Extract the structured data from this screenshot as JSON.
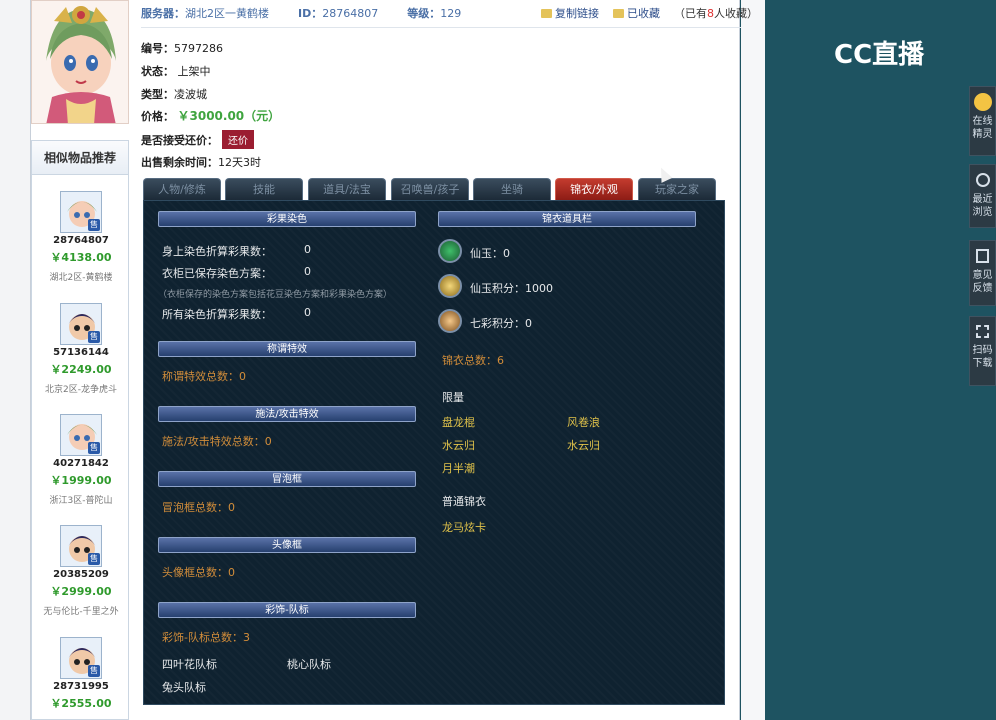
{
  "header": {
    "server_label": "服务器：",
    "server_value": "湖北2区一黄鹤楼",
    "id_label": "ID：",
    "id_value": "28764807",
    "level_label": "等级：",
    "level_value": "129",
    "copy_link": "复制链接",
    "favorited": "已收藏",
    "fav_count_prefix": "（已有",
    "fav_count": "8",
    "fav_count_suffix": "人收藏）"
  },
  "info": {
    "number_label": "编号：",
    "number_value": "5797286",
    "status_label": "状态：",
    "status_value": "上架中",
    "type_label": "类型：",
    "type_value": "凌波城",
    "price_label": "价格：",
    "price_value": "￥3000.00（元）",
    "counter_label": "是否接受还价：",
    "counter_button": "还价",
    "remaining_label": "出售剩余时间：",
    "remaining_value": "12天3时"
  },
  "similar": {
    "title": "相似物品推荐",
    "sale_tag": "售",
    "items": [
      {
        "id": "28764807",
        "price": "￥4138.00",
        "server": "湖北2区-黄鹤楼"
      },
      {
        "id": "57136144",
        "price": "￥2249.00",
        "server": "北京2区-龙争虎斗"
      },
      {
        "id": "40271842",
        "price": "￥1999.00",
        "server": "浙江3区-普陀山"
      },
      {
        "id": "20385209",
        "price": "￥2999.00",
        "server": "无与伦比-千里之外"
      },
      {
        "id": "28731995",
        "price": "￥2555.00",
        "server": ""
      }
    ]
  },
  "tabs": [
    {
      "label": "人物/修炼",
      "active": false
    },
    {
      "label": "技能",
      "active": false
    },
    {
      "label": "道具/法宝",
      "active": false
    },
    {
      "label": "召唤兽/孩子",
      "active": false
    },
    {
      "label": "坐骑",
      "active": false
    },
    {
      "label": "锦衣/外观",
      "active": true
    },
    {
      "label": "玩家之家",
      "active": false
    }
  ],
  "panel": {
    "dye_title": "彩果染色",
    "dye_body_label": "身上染色折算彩果数：",
    "dye_body_value": "0",
    "wardrobe_label": "衣柜已保存染色方案：",
    "wardrobe_value": "0",
    "wardrobe_note": "（衣柜保存的染色方案包括花豆染色方案和彩果染色方案）",
    "all_dye_label": "所有染色折算彩果数：",
    "all_dye_value": "0",
    "title_section": "称谓特效",
    "title_count": "称谓特效总数：0",
    "spell_section": "施法/攻击特效",
    "spell_count": "施法/攻击特效总数：0",
    "bubble_section": "冒泡框",
    "bubble_count": "冒泡框总数：0",
    "avatar_section": "头像框",
    "avatar_count": "头像框总数：0",
    "team_section": "彩饰-队标",
    "team_count": "彩饰-队标总数：3",
    "team_items": [
      "四叶花队标",
      "桃心队标",
      "兔头队标"
    ],
    "outfit_section": "锦衣道具栏",
    "xianyu_label": "仙玉：",
    "xianyu_value": "0",
    "xianyu_points_label": "仙玉积分：",
    "xianyu_points_value": "1000",
    "qicai_label": "七彩积分：",
    "qicai_value": "0",
    "outfit_count": "锦衣总数：6",
    "limited_label": "限量",
    "limited_items": [
      "盘龙棍",
      "风卷浪",
      "水云归",
      "水云归",
      "月半潮"
    ],
    "normal_label": "普通锦衣",
    "normal_items": [
      "龙马炫卡"
    ]
  },
  "right": {
    "logo": "CC直播",
    "buttons": [
      {
        "label": "在线精灵",
        "icon": "sprite-icon"
      },
      {
        "label": "最近浏览",
        "icon": "clock-icon"
      },
      {
        "label": "意见反馈",
        "icon": "edit-icon"
      },
      {
        "label": "扫码下载",
        "icon": "scan-icon"
      }
    ]
  }
}
